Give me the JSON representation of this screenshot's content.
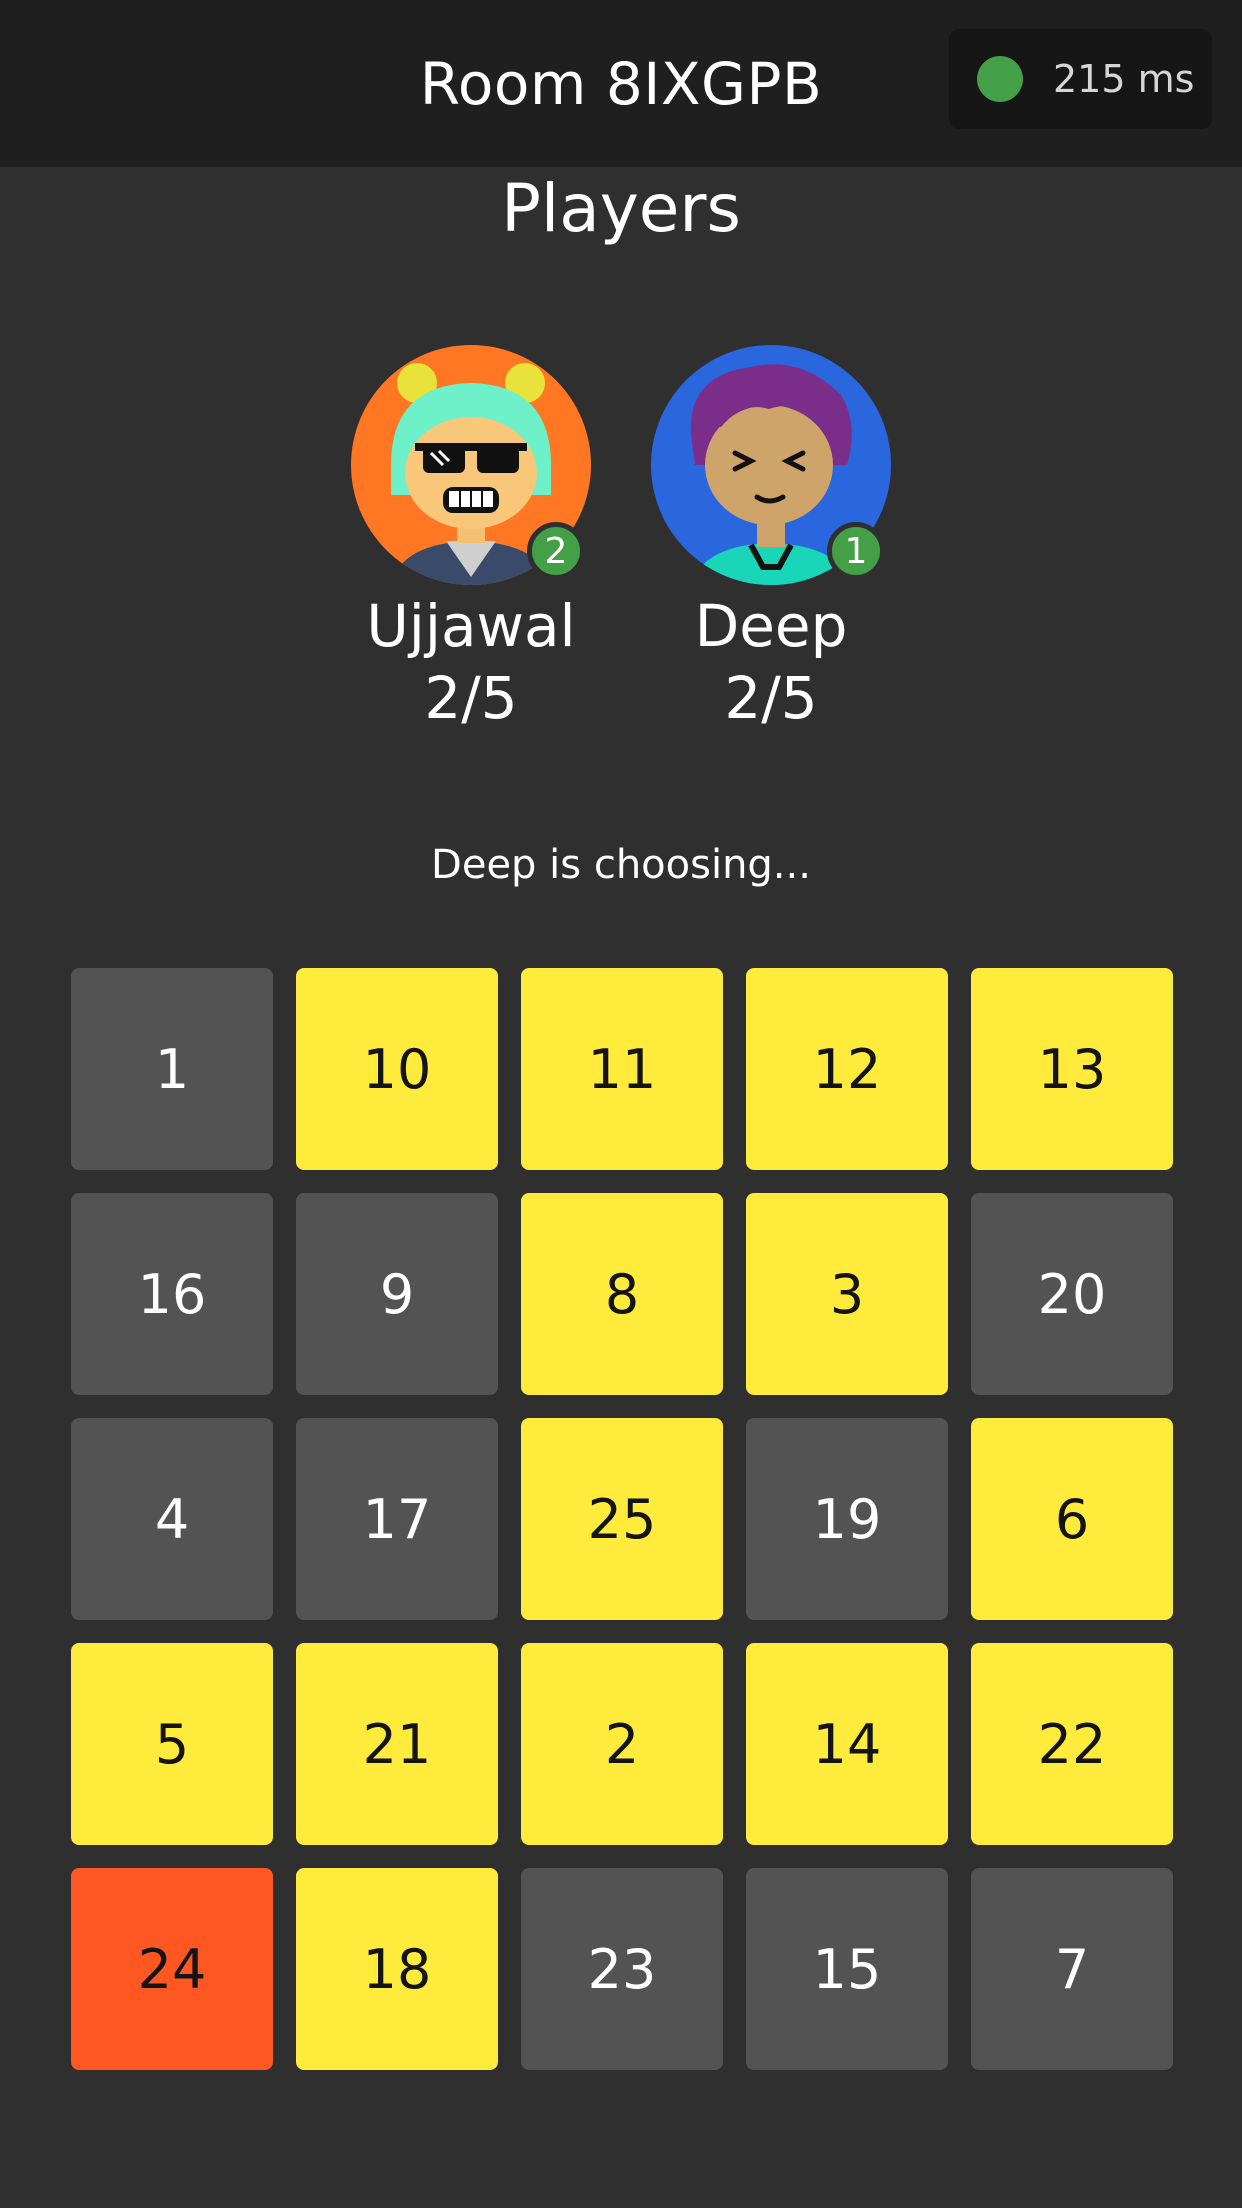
{
  "header": {
    "room_title": "Room 8IXGPB",
    "latency_label": "215 ms",
    "status_dot_color": "#43a047",
    "status_dot_icon": "connection-status-icon"
  },
  "players_section": {
    "title": "Players",
    "players": [
      {
        "name": "Ujjawal",
        "score": "2/5",
        "rank": "2",
        "avatar_icon": "avatar-sunglasses-icon",
        "avatar_bg": "#ff7722"
      },
      {
        "name": "Deep",
        "score": "2/5",
        "rank": "1",
        "avatar_icon": "avatar-purple-hair-icon",
        "avatar_bg": "#2a66de"
      }
    ]
  },
  "status_text": "Deep is choosing...",
  "board": {
    "colors": {
      "open": "#535353",
      "marked": "#ffeb3b",
      "last_called": "#ff5722"
    },
    "cells": [
      {
        "number": "1",
        "state": "open"
      },
      {
        "number": "10",
        "state": "marked"
      },
      {
        "number": "11",
        "state": "marked"
      },
      {
        "number": "12",
        "state": "marked"
      },
      {
        "number": "13",
        "state": "marked"
      },
      {
        "number": "16",
        "state": "open"
      },
      {
        "number": "9",
        "state": "open"
      },
      {
        "number": "8",
        "state": "marked"
      },
      {
        "number": "3",
        "state": "marked"
      },
      {
        "number": "20",
        "state": "open"
      },
      {
        "number": "4",
        "state": "open"
      },
      {
        "number": "17",
        "state": "open"
      },
      {
        "number": "25",
        "state": "marked"
      },
      {
        "number": "19",
        "state": "open"
      },
      {
        "number": "6",
        "state": "marked"
      },
      {
        "number": "5",
        "state": "marked"
      },
      {
        "number": "21",
        "state": "marked"
      },
      {
        "number": "2",
        "state": "marked"
      },
      {
        "number": "14",
        "state": "marked"
      },
      {
        "number": "22",
        "state": "marked"
      },
      {
        "number": "24",
        "state": "last"
      },
      {
        "number": "18",
        "state": "marked"
      },
      {
        "number": "23",
        "state": "open"
      },
      {
        "number": "15",
        "state": "open"
      },
      {
        "number": "7",
        "state": "open"
      }
    ]
  }
}
